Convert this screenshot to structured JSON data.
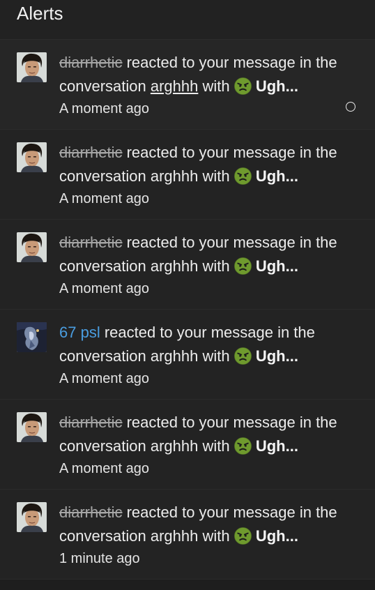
{
  "header": {
    "title": "Alerts"
  },
  "alerts": [
    {
      "user": "diarrhetic",
      "text_before": " reacted to your message in the conversation ",
      "conversation": "arghhh",
      "text_with": " with ",
      "reaction": "Ugh...",
      "time": "A moment ago"
    },
    {
      "user": "diarrhetic",
      "text_before": " reacted to your message in the conversation ",
      "conversation": "arghhh",
      "text_with": " with ",
      "reaction": "Ugh...",
      "time": "A moment ago"
    },
    {
      "user": "diarrhetic",
      "text_before": " reacted to your message in the conversation ",
      "conversation": "arghhh",
      "text_with": " with ",
      "reaction": "Ugh...",
      "time": "A moment ago"
    },
    {
      "user": "67 psl",
      "text_before": " reacted to your message in the conversation ",
      "conversation": "arghhh",
      "text_with": " with ",
      "reaction": "Ugh...",
      "time": "A moment ago"
    },
    {
      "user": "diarrhetic",
      "text_before": " reacted to your message in the conversation ",
      "conversation": "arghhh",
      "text_with": " with ",
      "reaction": "Ugh...",
      "time": "A moment ago"
    },
    {
      "user": "diarrhetic",
      "text_before": " reacted to your message in the conversation ",
      "conversation": "arghhh",
      "text_with": " with ",
      "reaction": "Ugh...",
      "time": "1 minute ago"
    }
  ],
  "colors": {
    "background": "#1e1e1e",
    "username_link": "#4a9de0",
    "username_struck": "#a6a6a6",
    "reaction_emoji": "#6f9a2e"
  },
  "icons": {
    "reaction": "sick-face-emoji-icon",
    "read_toggle": "circle-outline-icon"
  }
}
